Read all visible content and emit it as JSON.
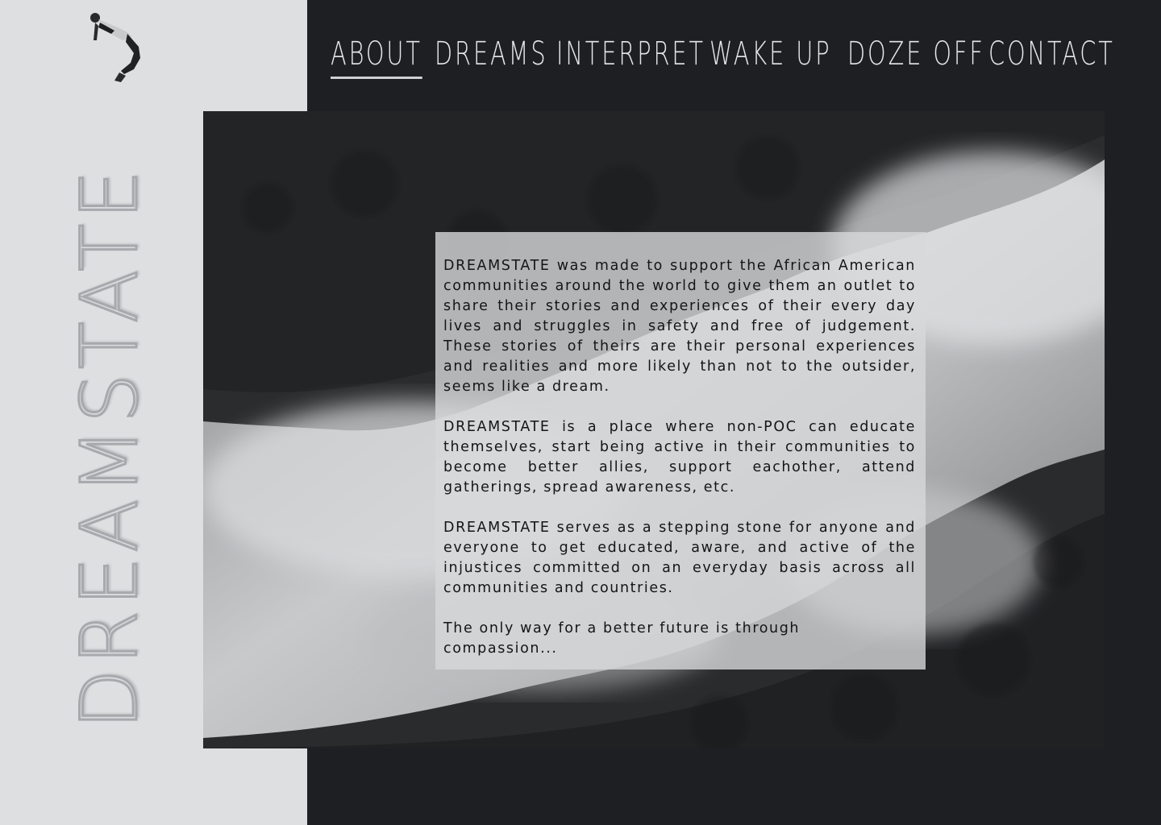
{
  "brand": {
    "name": "DREAMSTATE",
    "figure_icon": "falling-person-icon"
  },
  "nav": {
    "items": [
      {
        "label": "ABOUT",
        "active": true
      },
      {
        "label": "DREAMS",
        "active": false
      },
      {
        "label": "INTERPRET",
        "active": false
      },
      {
        "label": "WAKE UP",
        "active": false
      },
      {
        "label": "DOZE OFF",
        "active": false
      },
      {
        "label": "CONTACT",
        "active": false
      }
    ]
  },
  "about": {
    "paragraphs": [
      "DREAMSTATE was made to support the African American communities around the world to give them an outlet to share their stories and experiences of their every day lives and struggles in safety and free of judgement. These stories of theirs are their personal experiences and realities and more likely than not to the outsider, seems like a dream.",
      "DREAMSTATE is a place where non-POC can educate themselves, start being active in their communities to become better allies, support eachother, attend gatherings, spread awareness, etc.",
      "DREAMSTATE serves as a stepping stone for anyone and everyone to get educated, aware, and active of the injustices committed on an everyday basis across all communities and countries.",
      "The only way for a better future is through compassion..."
    ]
  },
  "colors": {
    "page_background": "#1e1f22",
    "sidebar_background": "#dedfe1",
    "nav_text": "#e6e6e8",
    "card_background": "#d7d8da"
  }
}
